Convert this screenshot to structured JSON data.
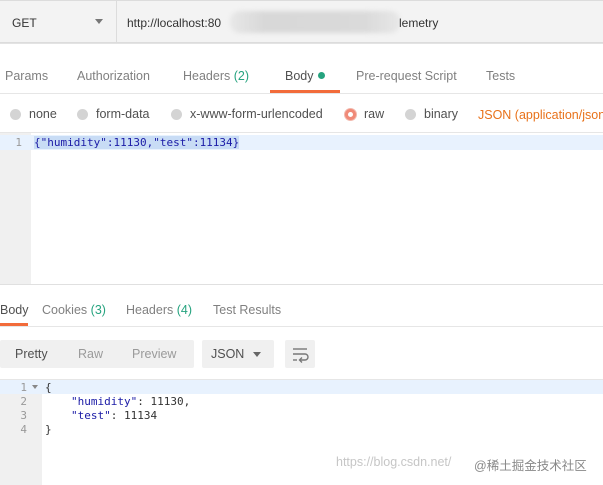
{
  "request": {
    "method": "GET",
    "url_start": "http://localhost:80",
    "url_end": "lemetry"
  },
  "request_tabs": {
    "params": "Params",
    "authorization": "Authorization",
    "headers": "Headers",
    "headers_count": "(2)",
    "body": "Body",
    "pre_request": "Pre-request Script",
    "tests": "Tests"
  },
  "body_types": {
    "none": "none",
    "form_data": "form-data",
    "urlencoded": "x-www-form-urlencoded",
    "raw": "raw",
    "binary": "binary",
    "selected": "raw",
    "content_type": "JSON (application/json"
  },
  "request_editor": {
    "line_numbers": [
      "1"
    ],
    "code": [
      "{\"humidity\":11130,\"test\":11134}"
    ]
  },
  "response_tabs": {
    "body": "Body",
    "cookies": "Cookies",
    "cookies_count": "(3)",
    "headers": "Headers",
    "headers_count": "(4)",
    "test_results": "Test Results"
  },
  "response_toolbar": {
    "pretty": "Pretty",
    "raw": "Raw",
    "preview": "Preview",
    "format": "JSON"
  },
  "response_body": {
    "line_numbers": [
      "1",
      "2",
      "3",
      "4"
    ],
    "line1": "{",
    "line2_key": "\"humidity\"",
    "line2_rest": ": 11130,",
    "line3_key": "\"test\"",
    "line3_rest": ": 11134",
    "line4": "}"
  },
  "watermark": {
    "url": "https://blog.csdn.net/",
    "site": "@稀土掘金技术社区"
  },
  "colors": {
    "accent_orange": "#f26b3a",
    "count_green": "#26a37f",
    "json_type_orange": "#e8721b"
  }
}
